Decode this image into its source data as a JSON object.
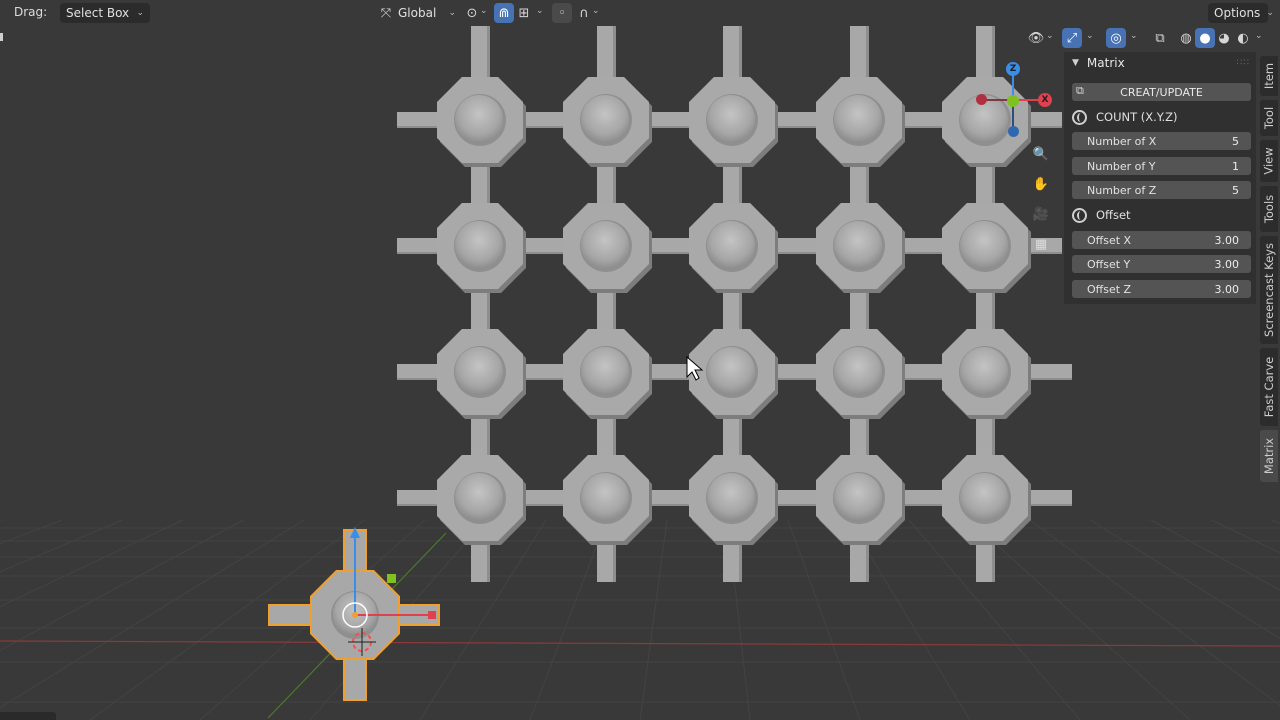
{
  "header": {
    "drag_label": "Drag:",
    "select_mode": "Select Box",
    "orientation": "Global",
    "options_label": "Options"
  },
  "panel": {
    "title": "Matrix",
    "create_update_label": "CREAT/UPDATE",
    "count_label": "COUNT (X.Y.Z)",
    "offset_label": "Offset",
    "count_fields": [
      {
        "label": "Number of X",
        "value": "5"
      },
      {
        "label": "Number of Y",
        "value": "1"
      },
      {
        "label": "Number of Z",
        "value": "5"
      }
    ],
    "offset_fields": [
      {
        "label": "Offset X",
        "value": "3.00"
      },
      {
        "label": "Offset Y",
        "value": "3.00"
      },
      {
        "label": "Offset Z",
        "value": "3.00"
      }
    ]
  },
  "tabs": [
    "Item",
    "Tool",
    "View",
    "Tools",
    "Screencast Keys",
    "Fast Carve",
    "Matrix"
  ],
  "active_tab": "Matrix",
  "gizmo": {
    "x": "X",
    "y": "Y",
    "z": "Z"
  },
  "colors": {
    "accent": "#4772b3",
    "selection_outline": "#f0a030",
    "axis_x": "#e04050",
    "axis_y": "#80c020",
    "axis_z": "#3b8ee8",
    "object_gray": "#a8a8a8"
  }
}
